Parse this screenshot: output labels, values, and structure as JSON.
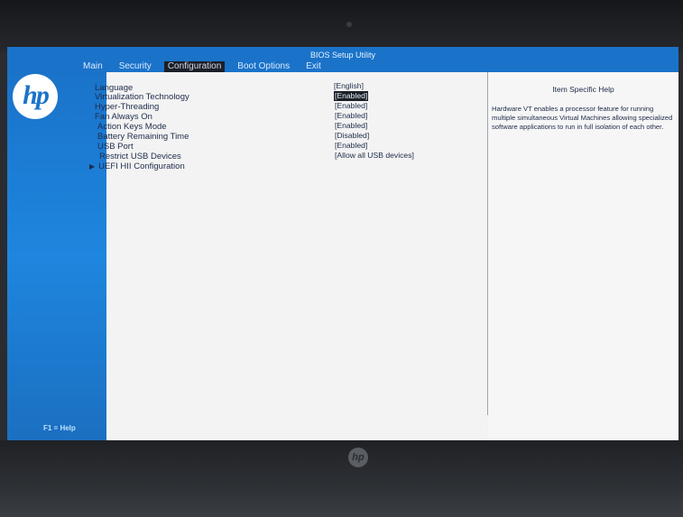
{
  "header": {
    "title": "BIOS Setup Utility",
    "tabs": [
      {
        "label": "Main"
      },
      {
        "label": "Security"
      },
      {
        "label": "Configuration"
      },
      {
        "label": "Boot Options"
      },
      {
        "label": "Exit"
      }
    ]
  },
  "settings": [
    {
      "label": "Language",
      "value": "[English]"
    },
    {
      "label": "Virtualization Technology",
      "value": "[Enabled]"
    },
    {
      "label": "Hyper-Threading",
      "value": "[Enabled]"
    },
    {
      "label": "Fan Always On",
      "value": "[Enabled]"
    },
    {
      "label": "Action Keys Mode",
      "value": "[Enabled]"
    },
    {
      "label": "Battery Remaining Time",
      "value": "[Disabled]"
    },
    {
      "label": "USB Port",
      "value": "[Enabled]"
    },
    {
      "label": "Restrict USB Devices",
      "value": "[Allow all USB devices]"
    }
  ],
  "submenu": {
    "label": "UEFI HII Configuration"
  },
  "help": {
    "title": "Item Specific Help",
    "text": "Hardware VT enables a processor feature for running multiple simultaneous Virtual Machines allowing specialized software applications to run in full isolation of each other."
  },
  "footer": {
    "f1": "F1 = Help"
  },
  "colors": {
    "accent": "#1a73c9",
    "selected_bg": "#1b1f27"
  }
}
